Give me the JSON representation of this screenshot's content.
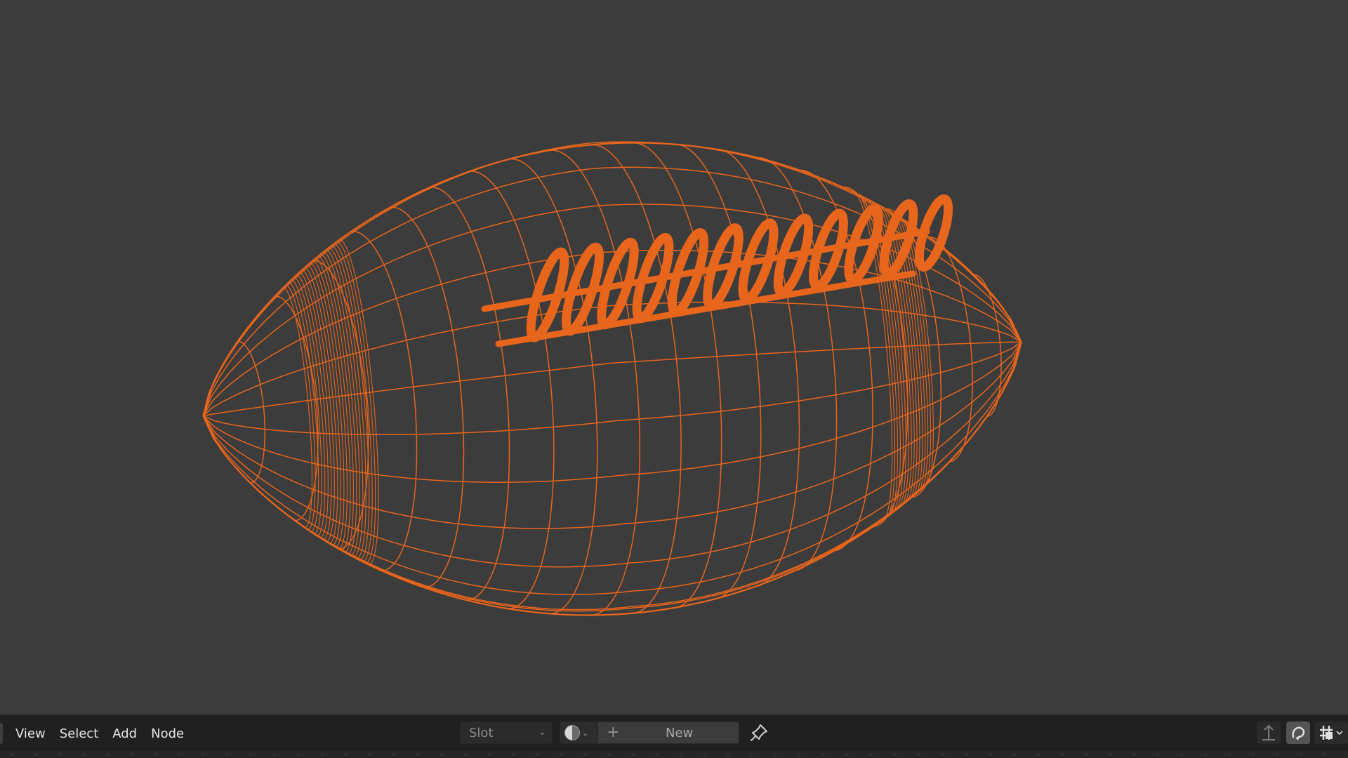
{
  "app": "Blender",
  "editor": "Shader Editor (wireframe preview)",
  "viewport": {
    "background_color": "#3c3c3c",
    "wire_color": "#e8651c",
    "object": "american-football-wireframe"
  },
  "header_menu": {
    "items": [
      {
        "label": "View"
      },
      {
        "label": "Select"
      },
      {
        "label": "Add"
      },
      {
        "label": "Node"
      }
    ]
  },
  "slot": {
    "value": "Slot"
  },
  "material": {
    "new_label": "New",
    "plus_icon": "+"
  },
  "icons": {
    "browse_material": "material-ball-icon",
    "pin": "pin-icon",
    "parent_node_tree": "arrow-up-icon",
    "snap": "magnet-icon",
    "snap_grid": "grid-snap-icon"
  }
}
